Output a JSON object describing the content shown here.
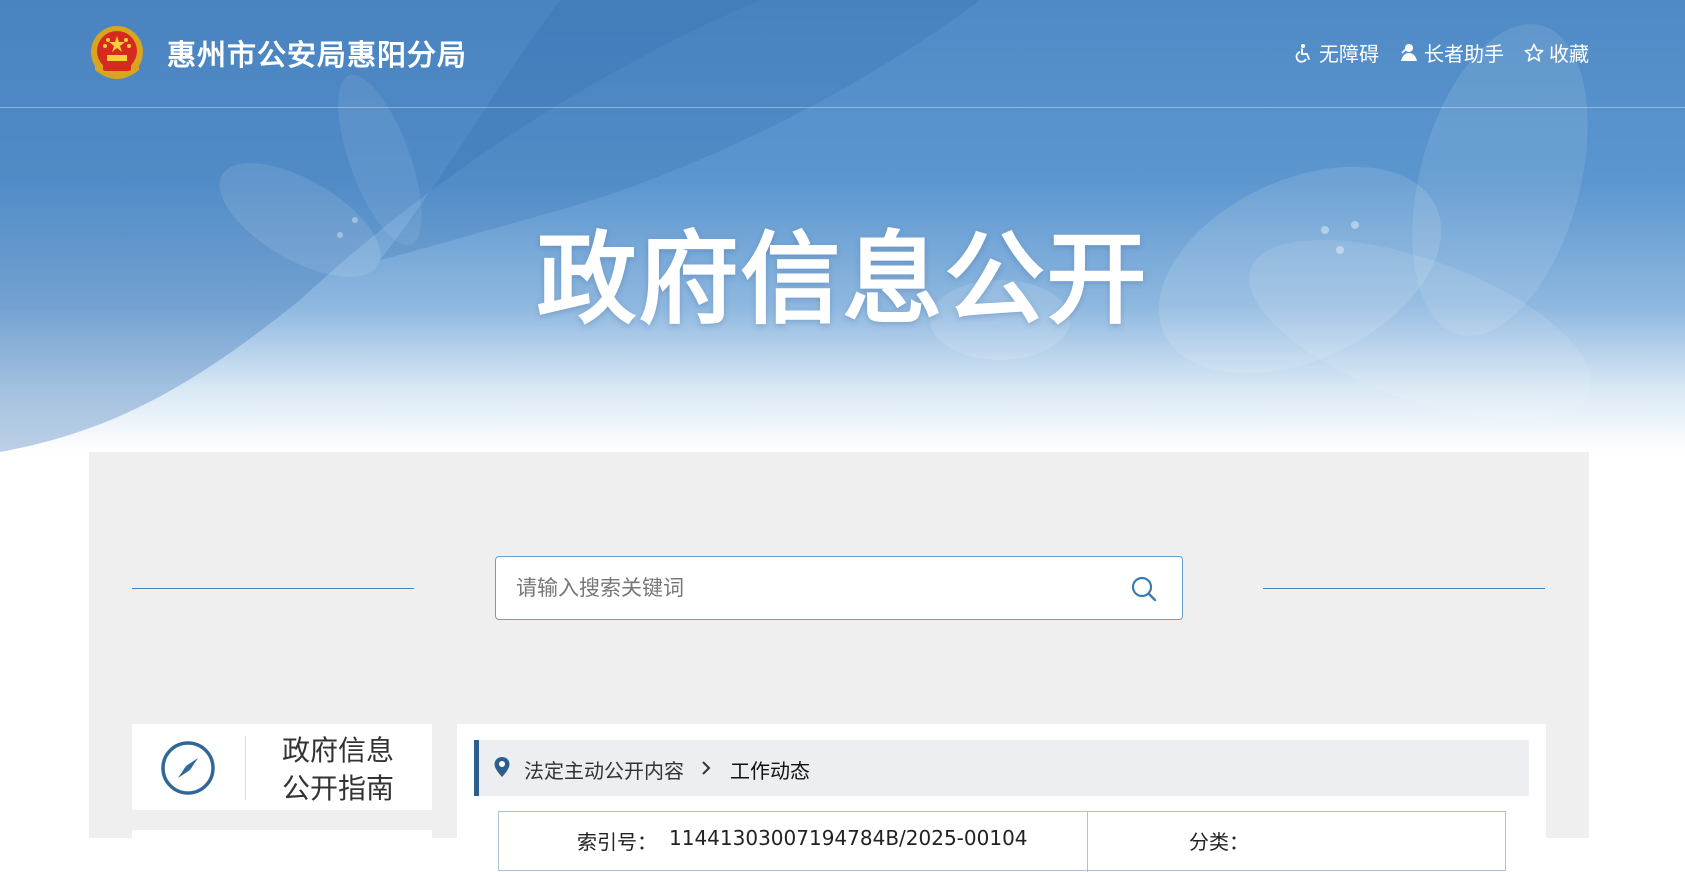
{
  "header": {
    "site_title": "惠州市公安局惠阳分局",
    "tools": [
      {
        "icon": "wheelchair-icon",
        "label": "无障碍"
      },
      {
        "icon": "elder-icon",
        "label": "长者助手"
      },
      {
        "icon": "star-icon",
        "label": "收藏"
      }
    ]
  },
  "hero": {
    "title": "政府信息公开"
  },
  "search": {
    "placeholder": "请输入搜索关键词",
    "value": ""
  },
  "sidebar": {
    "guide_label_line1": "政府信息",
    "guide_label_line2": "公开指南"
  },
  "breadcrumb": {
    "items": [
      "法定主动公开内容",
      "工作动态"
    ]
  },
  "meta": {
    "index_label": "索引号：",
    "index_value": "11441303007194784B/2025-00104",
    "category_label": "分类：",
    "category_value": ""
  },
  "colors": {
    "brand_blue": "#2c5f8e",
    "hero_blue": "#5b96cf",
    "panel_bg": "#efefef",
    "accent_line": "#4a86b5"
  }
}
